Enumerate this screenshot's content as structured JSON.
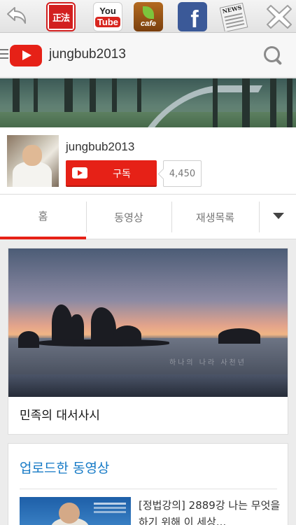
{
  "shortcuts": {
    "jungbub_seal": "正法",
    "youtube_top": "You",
    "youtube_bottom": "Tube",
    "cafe": "cafe",
    "facebook": "f",
    "news": "NEWS"
  },
  "header": {
    "title": "jungbub2013"
  },
  "channel": {
    "name": "jungbub2013",
    "subscribe_label": "구독",
    "subscriber_count": "4,450"
  },
  "tabs": [
    {
      "label": "홈"
    },
    {
      "label": "동영상"
    },
    {
      "label": "재생목록"
    }
  ],
  "featured": {
    "title": "민족의 대서사시",
    "watermark": "하나의 나라 사천년"
  },
  "uploads": {
    "heading": "업로드한 동영상",
    "items": [
      {
        "title": "[정법강의] 2889강 나는 무엇을 하기 위해 이 세상..."
      }
    ]
  },
  "colors": {
    "youtube_red": "#e62117",
    "link_blue": "#167ac6",
    "facebook_blue": "#3b5998"
  }
}
